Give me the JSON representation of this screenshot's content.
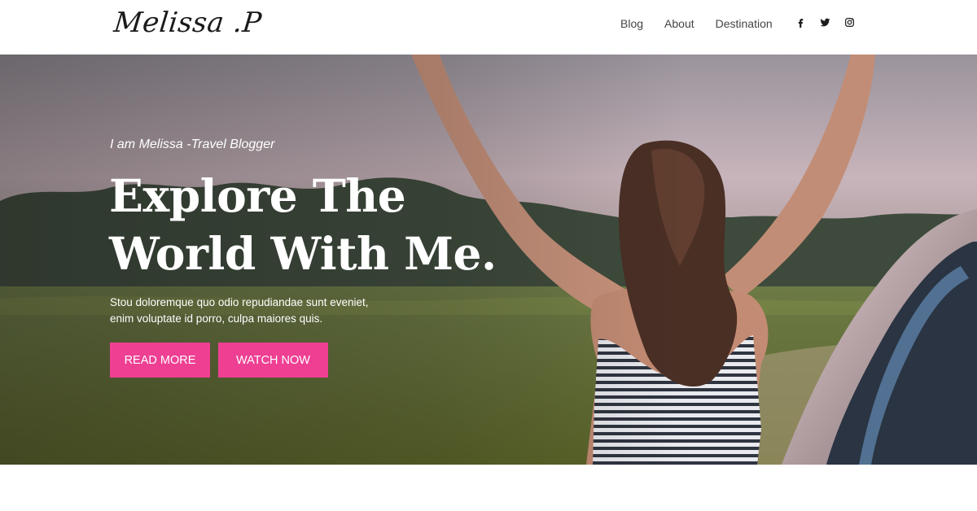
{
  "header": {
    "logo": "Melissa .P",
    "nav": [
      {
        "label": "Blog"
      },
      {
        "label": "About"
      },
      {
        "label": "Destination"
      }
    ],
    "social": [
      "facebook-icon",
      "twitter-icon",
      "instagram-icon"
    ]
  },
  "hero": {
    "tagline": "I am Melissa -Travel Blogger",
    "heading_line1": "Explore The",
    "heading_line2": "World With Me.",
    "description_line1": "Stou doloremque quo odio repudiandae sunt eveniet,",
    "description_line2": "enim voluptate id porro, culpa maiores quis.",
    "read_more_label": "READ MORE",
    "watch_now_label": "WATCH NOW"
  },
  "colors": {
    "accent": "#ee3f93",
    "text_dark": "#1b1b1b",
    "nav_text": "#444444",
    "hero_text": "#ffffff"
  }
}
